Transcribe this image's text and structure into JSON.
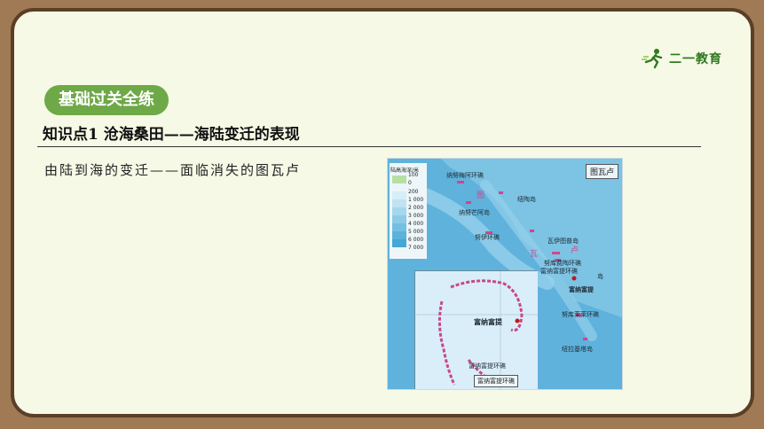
{
  "logo": {
    "text": "二一教育"
  },
  "badge": {
    "label": "基础过关全练"
  },
  "section": {
    "title": "知识点1 沧海桑田——海陆变迁的表现"
  },
  "subtitle": {
    "text": "由陆到海的变迁——面临消失的图瓦卢"
  },
  "map": {
    "box_title": "图瓦卢",
    "legend": {
      "title": "陆高海深/米",
      "values": [
        "100",
        "0",
        "200",
        "1 000",
        "2 000",
        "3 000",
        "4 000",
        "5 000",
        "6 000",
        "7 000"
      ],
      "colors": [
        "#b7dfa2",
        "#eaf6fb",
        "#d7eef8",
        "#bfe3f3",
        "#a6d7ee",
        "#8ccbe8",
        "#74bfe2",
        "#5bb3dc",
        "#44a7d5"
      ]
    },
    "labels": [
      "纳努梅阿环礁",
      "纽陶岛",
      "纳努芒阿岛",
      "努伊环礁",
      "瓦伊图普岛",
      "努库费陶环礁",
      "富纳富提环礁",
      "富纳富提",
      "努库莱莱环礁",
      "纽拉基塔岛",
      "图",
      "瓦",
      "卢",
      "岛"
    ],
    "inset": {
      "city": "富纳富提",
      "atoll_label": "富纳富提环礁",
      "caption": "富纳富提环礁"
    }
  }
}
